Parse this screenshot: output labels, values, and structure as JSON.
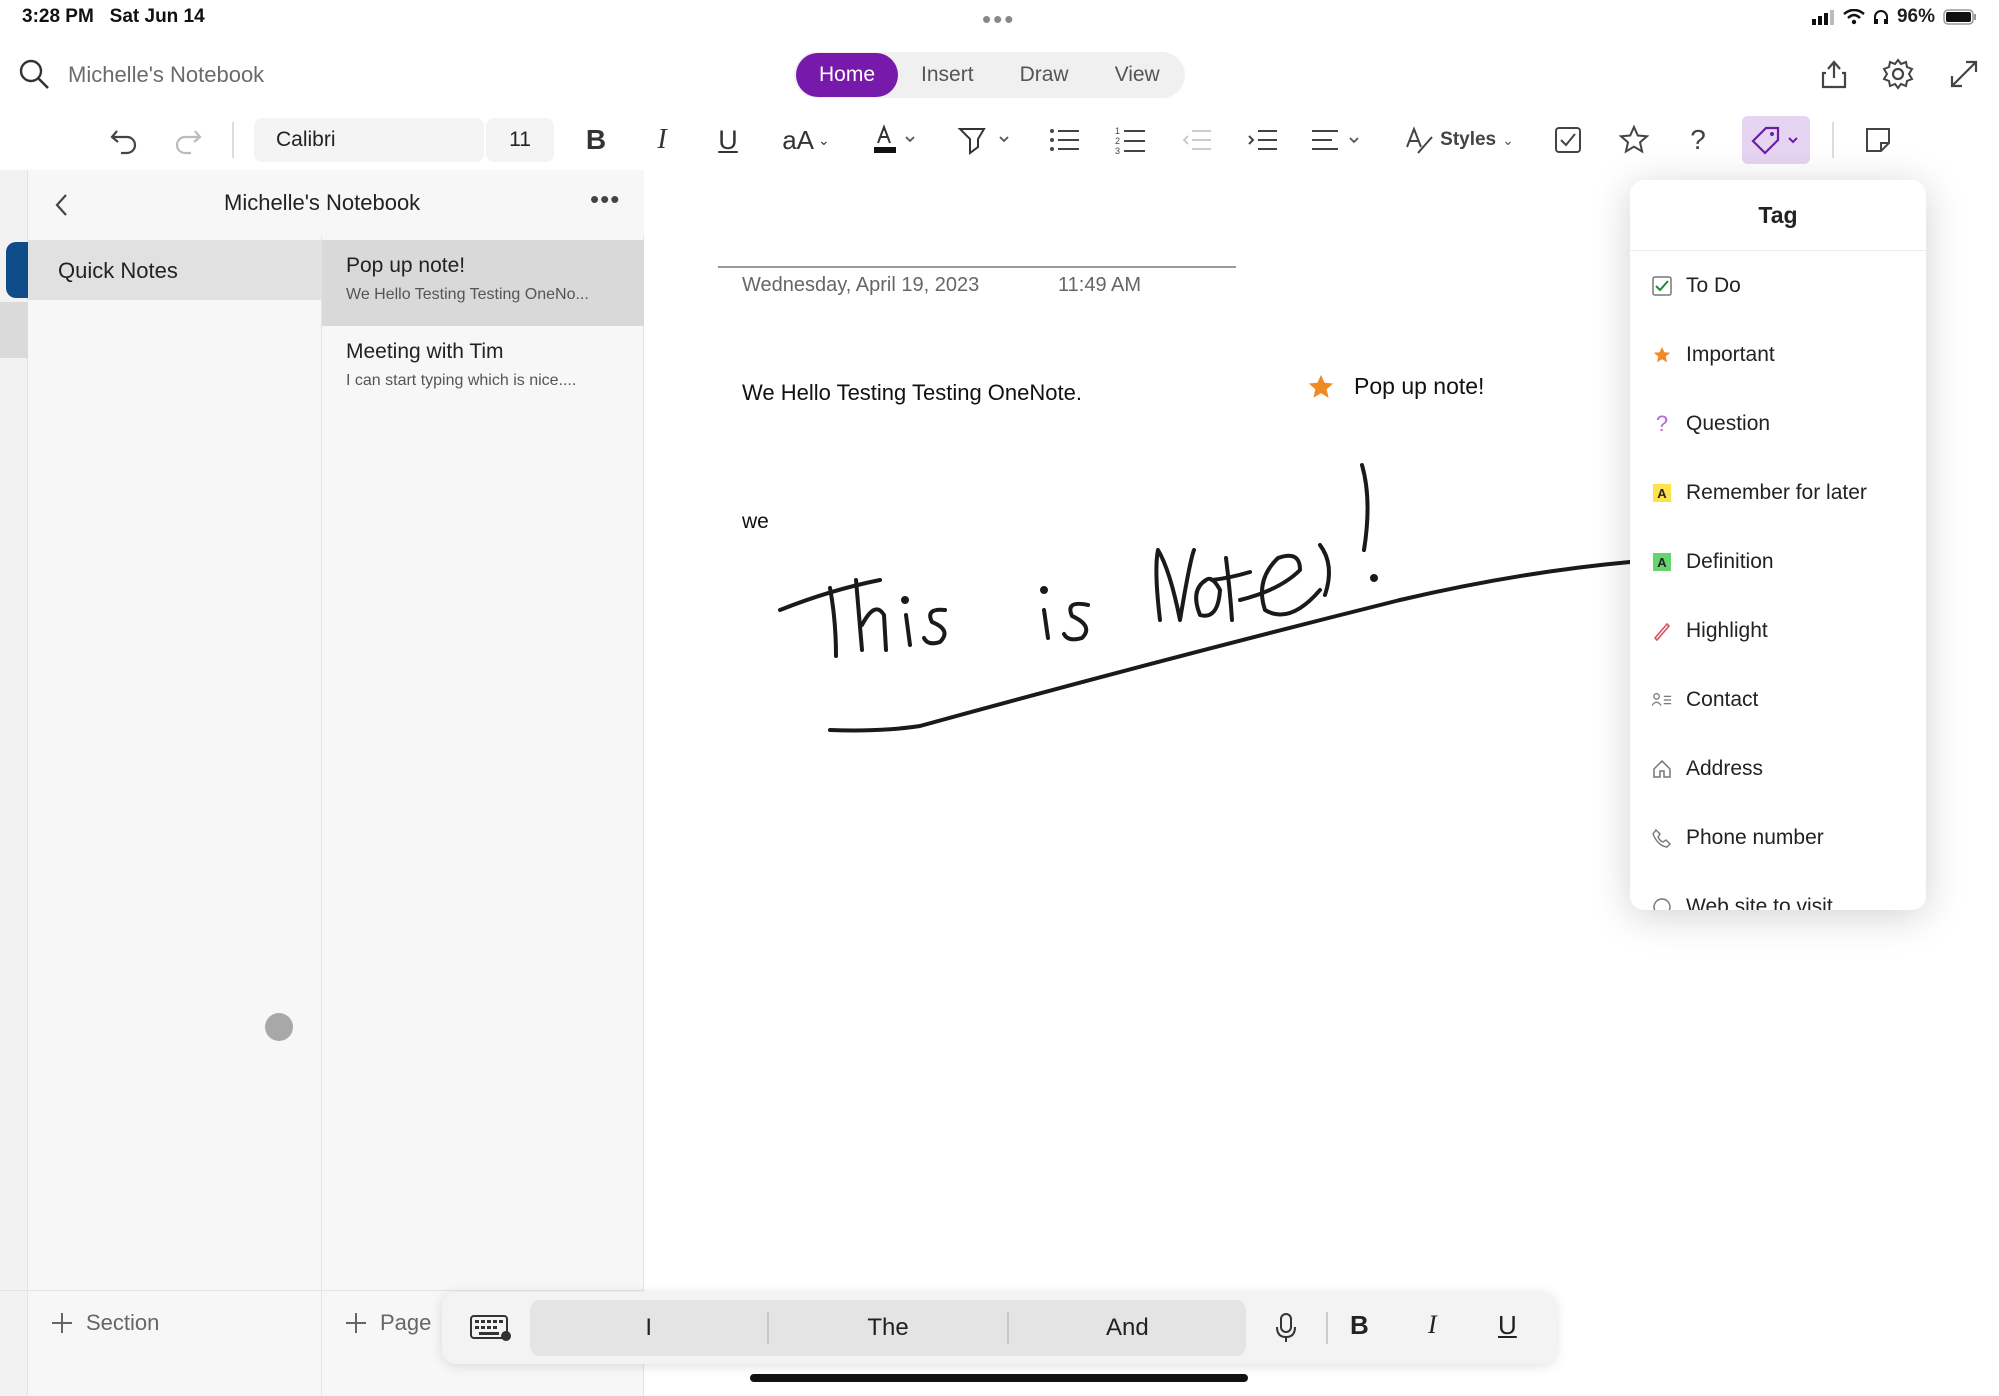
{
  "status_bar": {
    "time": "3:28 PM",
    "date": "Sat Jun 14",
    "battery": "96%",
    "dots": "•••"
  },
  "header": {
    "search_placeholder": "Michelle's Notebook",
    "tabs": [
      {
        "label": "Home",
        "active": true
      },
      {
        "label": "Insert",
        "active": false
      },
      {
        "label": "Draw",
        "active": false
      },
      {
        "label": "View",
        "active": false
      }
    ],
    "accent_color": "#7719aa"
  },
  "ribbon": {
    "font_name": "Calibri",
    "font_size": "11",
    "styles_label": "Styles",
    "icons": [
      "undo-icon",
      "redo-icon",
      "bold-icon",
      "italic-icon",
      "underline-icon",
      "font-size-case-icon",
      "font-color-icon",
      "highlighter-icon",
      "bullet-list-icon",
      "numbered-list-icon",
      "outdent-icon",
      "indent-icon",
      "align-icon",
      "styles-icon",
      "todo-checkbox-icon",
      "star-icon",
      "question-icon",
      "tag-icon",
      "sticky-note-icon"
    ]
  },
  "sidebar": {
    "notebook_title": "Michelle's Notebook",
    "more": "•••",
    "sections": [
      {
        "label": "Quick Notes",
        "color": "#0f4c8a"
      }
    ],
    "pages": [
      {
        "title": "Pop up note!",
        "snippet": "We Hello Testing Testing OneNo...",
        "selected": true
      },
      {
        "title": "Meeting with Tim",
        "snippet": "I can start typing which is nice....",
        "selected": false
      }
    ],
    "add_section": "Section",
    "add_page": "Page"
  },
  "note": {
    "date": "Wednesday, April 19, 2023",
    "time": "11:49 AM",
    "body": "We Hello Testing Testing OneNote.",
    "popup_text": "Pop up note!",
    "text_we": "we",
    "ink_label": "This is note!"
  },
  "tag_menu": {
    "title": "Tag",
    "items": [
      {
        "label": "To Do",
        "icon": "checkbox-icon"
      },
      {
        "label": "Important",
        "icon": "star-icon"
      },
      {
        "label": "Question",
        "icon": "question-icon"
      },
      {
        "label": "Remember for later",
        "icon": "yellow-a-icon"
      },
      {
        "label": "Definition",
        "icon": "green-a-icon"
      },
      {
        "label": "Highlight",
        "icon": "pen-icon"
      },
      {
        "label": "Contact",
        "icon": "contact-icon"
      },
      {
        "label": "Address",
        "icon": "home-icon"
      },
      {
        "label": "Phone number",
        "icon": "phone-icon"
      },
      {
        "label": "Web site to visit",
        "icon": "globe-icon"
      }
    ]
  },
  "keyboard_bar": {
    "suggestions": [
      "I",
      "The",
      "And"
    ],
    "bold": "B",
    "italic": "I",
    "underline": "U"
  }
}
